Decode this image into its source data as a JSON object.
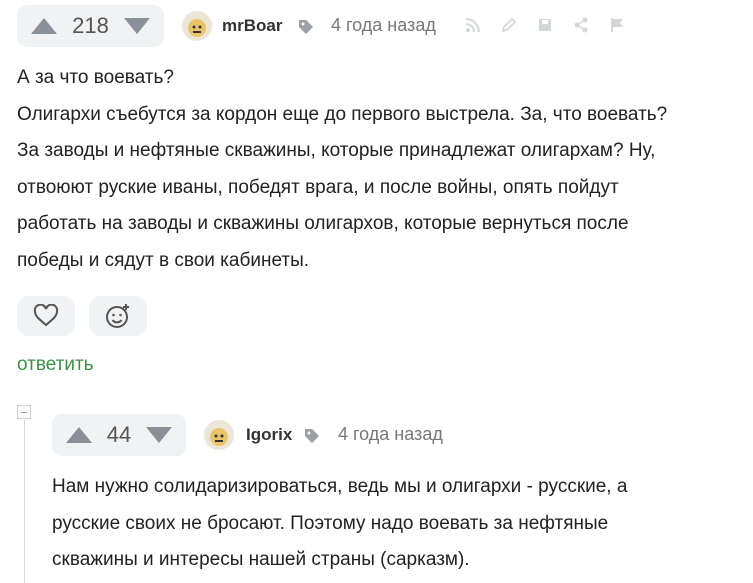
{
  "comment1": {
    "rating": "218",
    "username": "mrBoar",
    "time": "4 года назад",
    "lines": [
      "А за что воевать?",
      "Олигархи съебутся за кордон еще до первого выстрела. За, что воевать?",
      "За заводы и нефтяные скважины, которые принадлежат олигархам? Ну,",
      "отвоюют руские иваны, победят врага, и после войны, опять пойдут",
      "работать на заводы и скважины олигархов, которые вернуться после",
      "победы и сядут в свои кабинеты."
    ],
    "reply_label": "ответить"
  },
  "comment2": {
    "rating": "44",
    "username": "Igorix",
    "time": "4 года назад",
    "lines": [
      "Нам нужно солидаризироваться, ведь мы и олигархи - русские, а",
      "русские своих не бросают. Поэтому надо воевать за нефтяные",
      "скважины и интересы нашей страны (сарказм)."
    ]
  },
  "colors": {
    "accent_green": "#3b9244",
    "panel": "#f0f2f4",
    "muted": "#777777"
  }
}
